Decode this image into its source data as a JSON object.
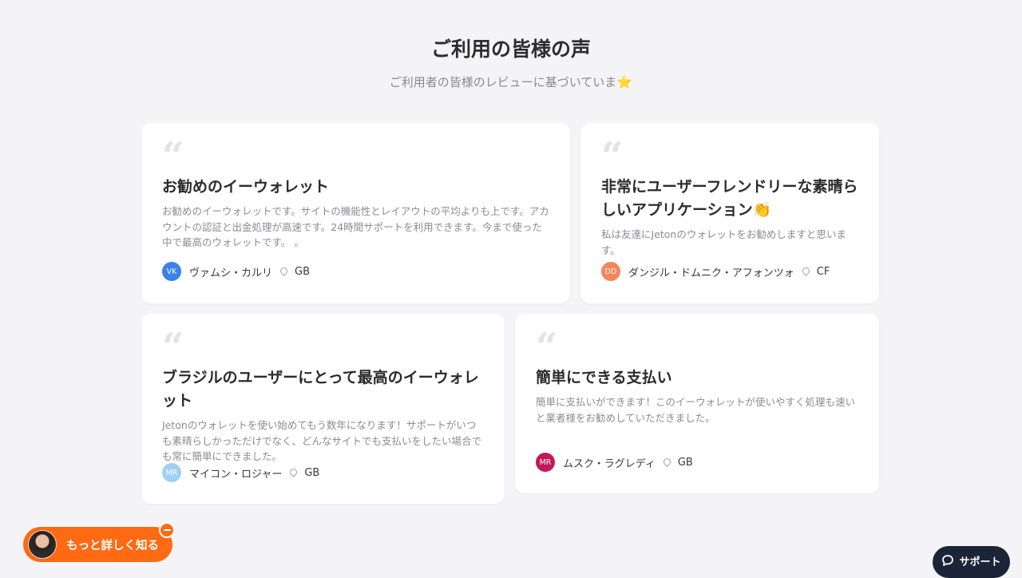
{
  "header": {
    "title": "ご利用の皆様の声",
    "subtitle": "ご利用者の皆様のレビューに基づいていま",
    "subtitle_icon": "⭐"
  },
  "quote_mark": "“",
  "reviews": [
    {
      "title": "お勧めのイーウォレット",
      "body": "お勧めのイーウォレットです。サイトの機能性とレイアウトの平均よりも上です。アカウントの認証と出金処理が高速です。24時間サポートを利用できます。今まで使った中で最高のウォレットです。 。",
      "initials": "VK",
      "name": "ヴァムシ・カルリ",
      "country": "GB",
      "avatar_color": "#3b82e6"
    },
    {
      "title": "非常にユーザーフレンドリーな素晴らしいアプリケーション",
      "title_emoji": "👏",
      "body": "私は友達にJetonのウォレットをお勧めしますと思います。",
      "initials": "DD",
      "name": "ダンジル・ドムニク・アフォンツォ",
      "country": "CF",
      "avatar_color": "#f4865a"
    },
    {
      "title": "ブラジルのユーザーにとって最高のイーウォレット",
      "body": "Jetonのウォレットを使い始めてもう数年になります！サポートがいつも素晴らしかっただけでなく、どんなサイトでも支払いをしたい場合でも常に簡単にできました。",
      "initials": "MR",
      "name": "マイコン・ロジャー",
      "country": "GB",
      "avatar_color": "#9fd0f5"
    },
    {
      "title": "簡単にできる支払い",
      "body": "簡単に支払いができます！このイーウォレットが使いやすく処理も速いと業者様をお勧めしていただきました。",
      "initials": "MR",
      "name": "ムスク・ラグレディ",
      "country": "GB",
      "avatar_color": "#c2185b"
    }
  ],
  "cta": {
    "label": "もっと詳しく知る"
  },
  "support": {
    "label": "サポート"
  },
  "colors": {
    "accent": "#ff6a13",
    "support_bg": "#1c2538",
    "page_bg": "#f4f4f6"
  }
}
